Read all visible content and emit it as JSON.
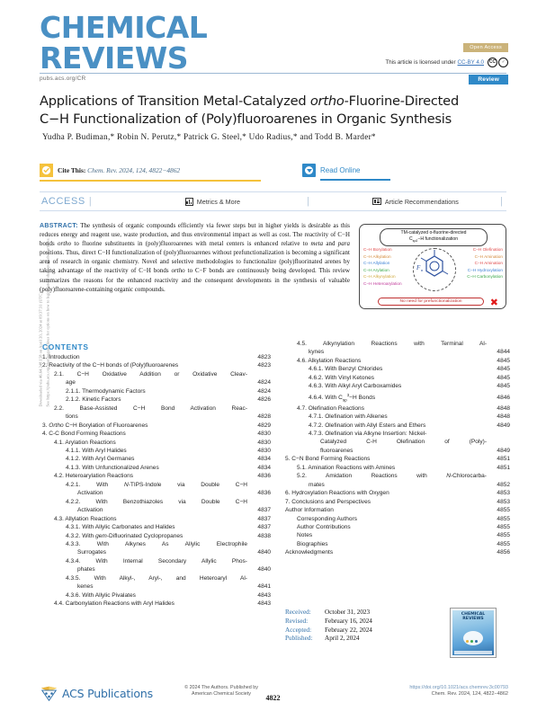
{
  "side_note": {
    "line1": "Downloaded via 46.64.248.158 on April 20, 2024 at 09:37:31 (UTC).",
    "line2": "See https://pubs.acs.org/sharingguidelines for options on how to legitimately share published articles."
  },
  "masthead": {
    "line1": "CHEMICAL",
    "line2": "REVIEWS",
    "pubs_url": "pubs.acs.org/CR",
    "open_access_badge": "Open Access",
    "license_prefix": "This article is licensed under",
    "license_link": "CC-BY 4.0",
    "cc_badge_1": "CC",
    "cc_badge_2": "BY",
    "article_type_badge": "Review"
  },
  "article": {
    "title_line1_a": "Applications of Transition Metal-Catalyzed ",
    "title_italic": "ortho",
    "title_line1_b": "-Fluorine-Directed",
    "title_line2": "C−H Functionalization of (Poly)fluoroarenes in Organic Synthesis",
    "authors": "Yudha P. Budiman,* Robin N. Perutz,* Patrick G. Steel,* Udo Radius,* and Todd B. Marder*"
  },
  "cite": {
    "label": "Cite This:",
    "citation": "Chem. Rev. 2024, 124, 4822−4862",
    "read_online": "Read Online"
  },
  "access_bar": {
    "access_label": "ACCESS",
    "separator": "|",
    "metrics": "Metrics & More",
    "recommendations": "Article Recommendations"
  },
  "abstract": {
    "label": "ABSTRACT:",
    "text_parts": [
      "The synthesis of organic compounds efficiently via fewer steps but in higher yields is desirable as this reduces energy and reagent use, waste production, and thus environmental impact as well as cost. The reactivity of C−H bonds ",
      "ortho",
      " to fluorine substituents in (poly)fluoroarenes with metal centers is enhanced relative to ",
      "meta",
      " and ",
      "para",
      " positions. Thus, direct C−H functionalization of (poly)fluoroarenes without prefunctionalization is becoming a significant area of research in organic chemistry. Novel and selective methodologies to functionalize (poly)fluorinated arenes by taking advantage of the reactivity of C−H bonds ",
      "ortho",
      " to C−F bonds are continuously being developed. This review summarizes the reasons for the enhanced reactivity and the consequent developments in the synthesis of valuable (poly)fluoroarene-containing organic compounds."
    ]
  },
  "graphical_abstract": {
    "title_line1": "TM-catalyzed o-fluorine-directed",
    "title_line2_pre": "C",
    "title_line2_sub": "sp2",
    "title_line2_post": "−H functionalization",
    "left_items": [
      {
        "label": "C−H Borylation",
        "color": "#e04a4a"
      },
      {
        "label": "C−H Alkylation",
        "color": "#d4893a"
      },
      {
        "label": "C−H Allylation",
        "color": "#3a7fd4"
      },
      {
        "label": "C−H Arylation",
        "color": "#3aa84a"
      },
      {
        "label": "C−H Alkynylation",
        "color": "#cfa83a"
      },
      {
        "label": "C−H Heteroarylation",
        "color": "#c03a9a"
      }
    ],
    "right_items": [
      {
        "label": "C−H Olefination",
        "color": "#e04a4a"
      },
      {
        "label": "C−H Amination",
        "color": "#d4893a"
      },
      {
        "label": "C−H Amination",
        "color": "#e04a4a"
      },
      {
        "label": "C−H Hydroxylation",
        "color": "#3a7fd4"
      },
      {
        "label": "C−H Carbonylation",
        "color": "#3aa84a"
      }
    ],
    "fn_label": "Fn",
    "bottom_banner": "No need for prefunctionalization",
    "bottom_mark": "✖"
  },
  "contents": {
    "heading": "CONTENTS",
    "left": [
      {
        "level": 1,
        "text": "1. Introduction",
        "page": "4823"
      },
      {
        "level": 1,
        "text": "2. Reactivity of the C−H bonds of (Poly)fluoroarenes",
        "page": "4823"
      },
      {
        "level": 2,
        "text": "2.1. C−H Oxidative Addition or Oxidative Cleav-",
        "page": "",
        "justify": true
      },
      {
        "level": "c2",
        "text": "age",
        "page": "4824"
      },
      {
        "level": 3,
        "text": "2.1.1. Thermodynamic Factors",
        "page": "4824"
      },
      {
        "level": 3,
        "text": "2.1.2. Kinetic Factors",
        "page": "4826"
      },
      {
        "level": 2,
        "text": "2.2. Base-Assisted C−H Bond Activation Reac-",
        "page": "",
        "justify": true
      },
      {
        "level": "c2",
        "text": "tions",
        "page": "4828"
      },
      {
        "level": 1,
        "text": "3. Ortho C−H Borylation of Fluoroarenes",
        "page": "4829",
        "italic_start": "Ortho"
      },
      {
        "level": 1,
        "text": "4. C-C Bond Forming Reactions",
        "page": "4830"
      },
      {
        "level": 2,
        "text": "4.1. Arylation Reactions",
        "page": "4830"
      },
      {
        "level": 3,
        "text": "4.1.1. With Aryl Halides",
        "page": "4830"
      },
      {
        "level": 3,
        "text": "4.1.2. With Aryl Germanes",
        "page": "4834"
      },
      {
        "level": 3,
        "text": "4.1.3. With Unfunctionalized Arenes",
        "page": "4834"
      },
      {
        "level": 2,
        "text": "4.2. Heteroarylation Reactions",
        "page": "4836"
      },
      {
        "level": 3,
        "text": "4.2.1. With N-TIPS-Indole via Double C−H",
        "page": "",
        "justify": true
      },
      {
        "level": "c3",
        "text": "Activation",
        "page": "4836"
      },
      {
        "level": 3,
        "text": "4.2.2. With Benzothiazoles via Double C−H",
        "page": "",
        "justify": true
      },
      {
        "level": "c3",
        "text": "Activation",
        "page": "4837"
      },
      {
        "level": 2,
        "text": "4.3. Allylation Reactions",
        "page": "4837"
      },
      {
        "level": 3,
        "text": "4.3.1. With Allylic Carbonates and Halides",
        "page": "4837"
      },
      {
        "level": 3,
        "text": "4.3.2. With gem-Difluorinated Cyclopropanes",
        "page": "4838"
      },
      {
        "level": 3,
        "text": "4.3.3. With Alkynes As Allylic Electrophile",
        "page": "",
        "justify": true
      },
      {
        "level": "c3",
        "text": "Surrogates",
        "page": "4840"
      },
      {
        "level": 3,
        "text": "4.3.4. With Internal Secondary Allylic Phos-",
        "page": "",
        "justify": true
      },
      {
        "level": "c3",
        "text": "phates",
        "page": "4840"
      },
      {
        "level": 3,
        "text": "4.3.5. With Alkyl-, Aryl-, and Heteroaryl Al-",
        "page": "",
        "justify": true
      },
      {
        "level": "c3",
        "text": "kenes",
        "page": "4841"
      },
      {
        "level": 3,
        "text": "4.3.6. With Allylic Pivalates",
        "page": "4843"
      },
      {
        "level": 2,
        "text": "4.4. Carbonylation Reactions with Aryl Halides",
        "page": "4843"
      }
    ],
    "right": [
      {
        "level": 2,
        "text": "4.5. Alkynylation Reactions with Terminal Al-",
        "page": "",
        "justify": true
      },
      {
        "level": "c2",
        "text": "kynes",
        "page": "4844"
      },
      {
        "level": 2,
        "text": "4.6. Alkylation Reactions",
        "page": "4845"
      },
      {
        "level": 3,
        "text": "4.6.1. With Benzyl Chlorides",
        "page": "4845"
      },
      {
        "level": 3,
        "text": "4.6.2. With Vinyl Ketones",
        "page": "4845"
      },
      {
        "level": 3,
        "text": "4.6.3. With Alkyl Aryl Carboxamides",
        "page": "4845"
      },
      {
        "level": 3,
        "text": "4.6.4. With Csp3−H Bonds",
        "page": "4846",
        "sub": true
      },
      {
        "level": 2,
        "text": "4.7. Olefination Reactions",
        "page": "4848"
      },
      {
        "level": 3,
        "text": "4.7.1. Olefination with Alkenes",
        "page": "4848"
      },
      {
        "level": 3,
        "text": "4.7.2. Olefination with Allyl Esters and Ethers",
        "page": "4849"
      },
      {
        "level": 3,
        "text": "4.7.3. Olefination via Alkyne Insertion: Nickel-",
        "page": ""
      },
      {
        "level": "c3",
        "text": "Catalyzed C-H Olefination of (Poly)-",
        "page": "",
        "justify": true
      },
      {
        "level": "c3",
        "text": "fluoroarenes",
        "page": "4849"
      },
      {
        "level": 1,
        "text": "5. C−N Bond Forming Reactions",
        "page": "4851"
      },
      {
        "level": 2,
        "text": "5.1. Amination Reactions with Amines",
        "page": "4851"
      },
      {
        "level": 2,
        "text": "5.2. Amidation Reactions with N-Chlorocarba-",
        "page": "",
        "justify": true
      },
      {
        "level": "c2",
        "text": "mates",
        "page": "4852"
      },
      {
        "level": 1,
        "text": "6. Hydroxylation Reactions with Oxygen",
        "page": "4853"
      },
      {
        "level": 1,
        "text": "7. Conclusions and Perspectives",
        "page": "4853"
      },
      {
        "level": 1,
        "text": "Author Information",
        "page": "4855"
      },
      {
        "level": 2,
        "text": "Corresponding Authors",
        "page": "4855"
      },
      {
        "level": 2,
        "text": "Author Contributions",
        "page": "4855"
      },
      {
        "level": 2,
        "text": "Notes",
        "page": "4855"
      },
      {
        "level": 2,
        "text": "Biographies",
        "page": "4855"
      },
      {
        "level": 1,
        "text": "Acknowledgments",
        "page": "4856"
      }
    ]
  },
  "dates": [
    {
      "key": "Received:",
      "value": "October 31, 2023"
    },
    {
      "key": "Revised:",
      "value": "February 16, 2024"
    },
    {
      "key": "Accepted:",
      "value": "February 22, 2024"
    },
    {
      "key": "Published:",
      "value": "April 2, 2024"
    }
  ],
  "cover_thumb": {
    "title_line1": "CHEMICAL",
    "title_line2": "REVIEWS"
  },
  "footer": {
    "publisher": "ACS Publications",
    "copyright_line1": "© 2024 The Authors. Published by",
    "copyright_line2": "American Chemical Society",
    "page_number": "4822",
    "doi": "https://doi.org/10.1021/acs.chemrev.3c00793",
    "citation": "Chem. Rev. 2024, 124, 4822−4862"
  }
}
